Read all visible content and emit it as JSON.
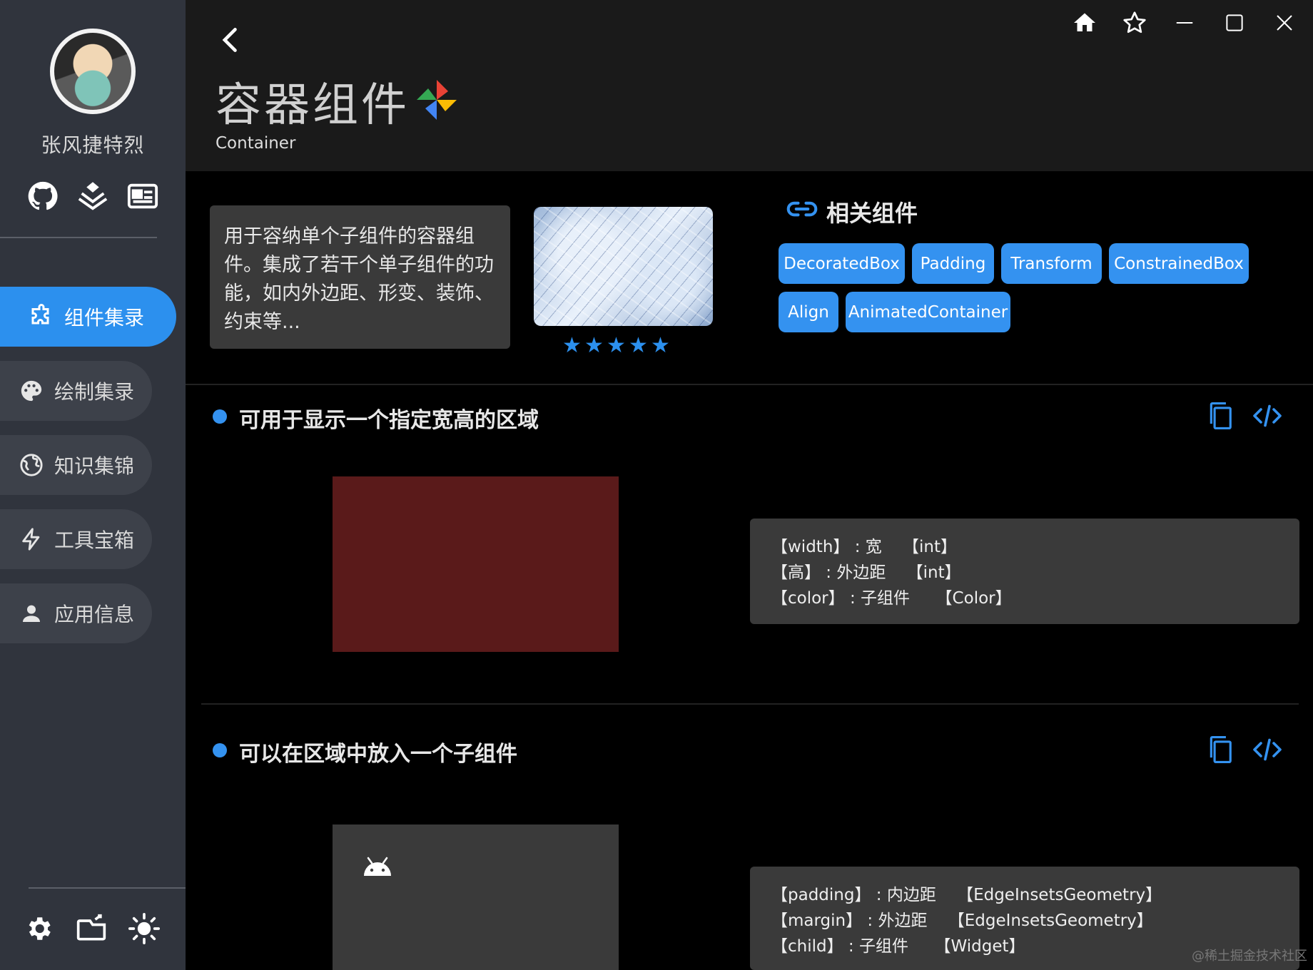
{
  "user": {
    "name": "张风捷特烈"
  },
  "sidebar": {
    "social_icons": [
      "github-icon",
      "juejin-icon",
      "card-icon"
    ],
    "nav": [
      {
        "label": "组件集录",
        "icon": "puzzle-icon",
        "active": true
      },
      {
        "label": "绘制集录",
        "icon": "palette-icon",
        "active": false
      },
      {
        "label": "知识集锦",
        "icon": "globe-icon",
        "active": false
      },
      {
        "label": "工具宝箱",
        "icon": "flash-icon",
        "active": false
      },
      {
        "label": "应用信息",
        "icon": "person-icon",
        "active": false
      }
    ],
    "bottom_icons": [
      "settings-icon",
      "folder-icon",
      "brightness-icon"
    ]
  },
  "window": {
    "controls": [
      "home-icon",
      "star-outline-icon",
      "minimize-icon",
      "maximize-icon",
      "close-icon"
    ]
  },
  "header": {
    "title": "容器组件",
    "subtitle": "Container"
  },
  "intro": {
    "description": "用于容纳单个子组件的容器组件。集成了若干个单子组件的功能，如内外边距、形变、装饰、约束等...",
    "rating": 5
  },
  "related": {
    "title": "相关组件",
    "items": [
      "DecoratedBox",
      "Padding",
      "Transform",
      "ConstrainedBox",
      "Align",
      "AnimatedContainer"
    ]
  },
  "sections": [
    {
      "title": "可用于显示一个指定宽高的区域",
      "demo_color": "#5a1a1a",
      "props": [
        "【width】 : 宽    【int】",
        "【高】 : 外边距    【int】",
        "【color】 : 子组件     【Color】"
      ]
    },
    {
      "title": "可以在区域中放入一个子组件",
      "demo_color": "#3a3a3a",
      "props": [
        "【padding】 : 内边距    【EdgeInsetsGeometry】",
        "【margin】 : 外边距    【EdgeInsetsGeometry】",
        "【child】 : 子组件     【Widget】"
      ]
    }
  ],
  "watermark": "@稀土掘金技术社区",
  "colors": {
    "accent": "#3492f0",
    "sidebar": "#30343d",
    "header": "#1a1a1a"
  }
}
